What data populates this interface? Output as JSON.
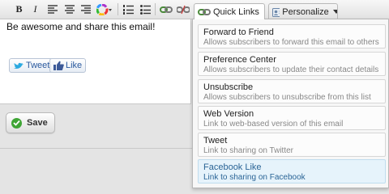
{
  "toolbar": {
    "buttons": [
      "bold-icon",
      "italic-icon",
      "align-left-icon",
      "align-center-icon",
      "align-right-icon",
      "color-wheel-icon",
      "ordered-list-icon",
      "unordered-list-icon",
      "link-icon",
      "unlink-icon"
    ]
  },
  "editor": {
    "text": "Be awesome and share this email!",
    "tweet_label": "Tweet",
    "like_label": "Like"
  },
  "save": {
    "label": "Save"
  },
  "tabs": {
    "quick_links": "Quick Links",
    "personalize": "Personalize"
  },
  "quick_links": [
    {
      "title": "Forward to Friend",
      "desc": "Allows subscribers to forward this email to others"
    },
    {
      "title": "Preference Center",
      "desc": "Allows subscribers to update their contact details"
    },
    {
      "title": "Unsubscribe",
      "desc": "Allows subscribers to unsubscribe from this list"
    },
    {
      "title": "Web Version",
      "desc": "Link to web-based version of this email"
    },
    {
      "title": "Tweet",
      "desc": "Link to sharing on Twitter"
    },
    {
      "title": "Facebook Like",
      "desc": "Link to sharing on Facebook"
    }
  ],
  "colors": {
    "save_check": "#3fa535",
    "twitter": "#2aa9e0",
    "facebook": "#3b5998",
    "active_item_bg": "#e6f3fb"
  }
}
